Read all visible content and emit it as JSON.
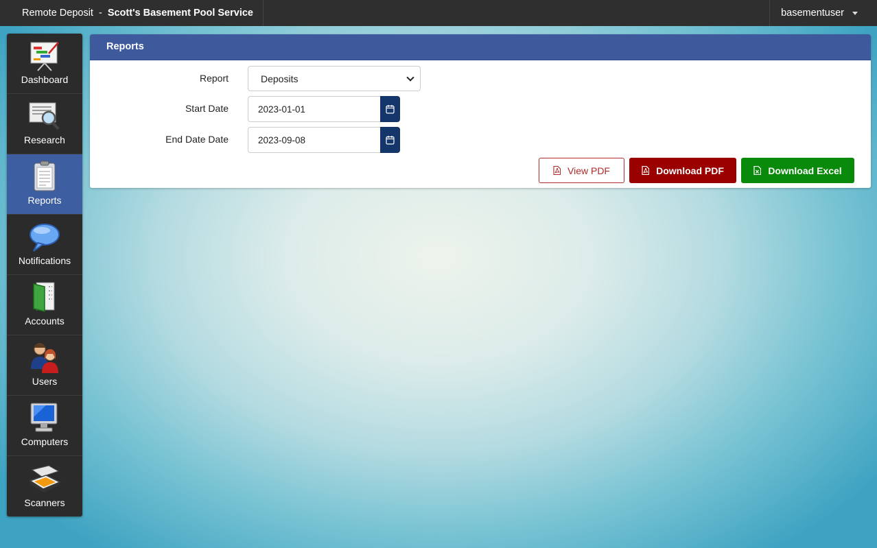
{
  "topbar": {
    "app_name": "Remote Deposit",
    "separator": "-",
    "company": "Scott's Basement Pool Service",
    "username": "basementuser"
  },
  "sidebar": {
    "items": [
      {
        "label": "Dashboard",
        "icon": "dashboard-chart-icon"
      },
      {
        "label": "Research",
        "icon": "magnifier-document-icon"
      },
      {
        "label": "Reports",
        "icon": "clipboard-report-icon",
        "active": true
      },
      {
        "label": "Notifications",
        "icon": "speech-bubble-icon"
      },
      {
        "label": "Accounts",
        "icon": "ledger-book-icon"
      },
      {
        "label": "Users",
        "icon": "users-people-icon"
      },
      {
        "label": "Computers",
        "icon": "monitor-icon"
      },
      {
        "label": "Scanners",
        "icon": "scanner-icon"
      }
    ]
  },
  "panel": {
    "title": "Reports",
    "report_label": "Report",
    "report_value": "Deposits",
    "start_label": "Start Date",
    "start_value": "2023-01-01",
    "end_label": "End Date Date",
    "end_value": "2023-09-08",
    "view_pdf_label": "View PDF",
    "download_pdf_label": "Download PDF",
    "download_excel_label": "Download Excel"
  },
  "colors": {
    "topbar": "#2f2f2f",
    "sidebar": "#2b2b2b",
    "active_nav": "#3d5ea1",
    "panel_header": "#3e5a9c",
    "calendar_button": "#14366b",
    "pdf_red": "#9a0000",
    "excel_green": "#0a8a0a"
  }
}
